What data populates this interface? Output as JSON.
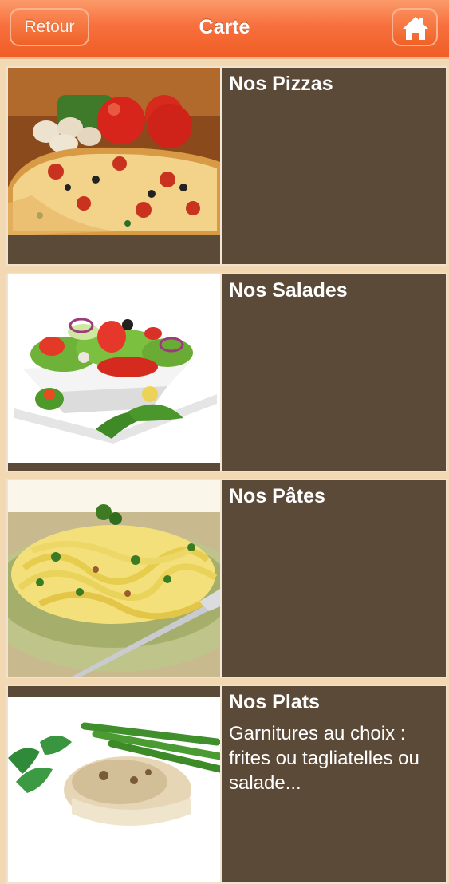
{
  "header": {
    "back_label": "Retour",
    "title": "Carte",
    "home_icon": "home-icon"
  },
  "menu": {
    "items": [
      {
        "name": "Nos Pizzas",
        "description": "",
        "image": "pizza-photo"
      },
      {
        "name": "Nos Salades",
        "description": "",
        "image": "salad-photo"
      },
      {
        "name": "Nos Pâtes",
        "description": "",
        "image": "pasta-photo"
      },
      {
        "name": "Nos Plats",
        "description": "Garnitures au choix : frites ou tagliatelles ou salade...",
        "image": "dish-photo"
      }
    ]
  },
  "colors": {
    "header_orange": "#f05d25",
    "card_brown": "#5c4a38",
    "page_background": "#f3d8b4"
  }
}
